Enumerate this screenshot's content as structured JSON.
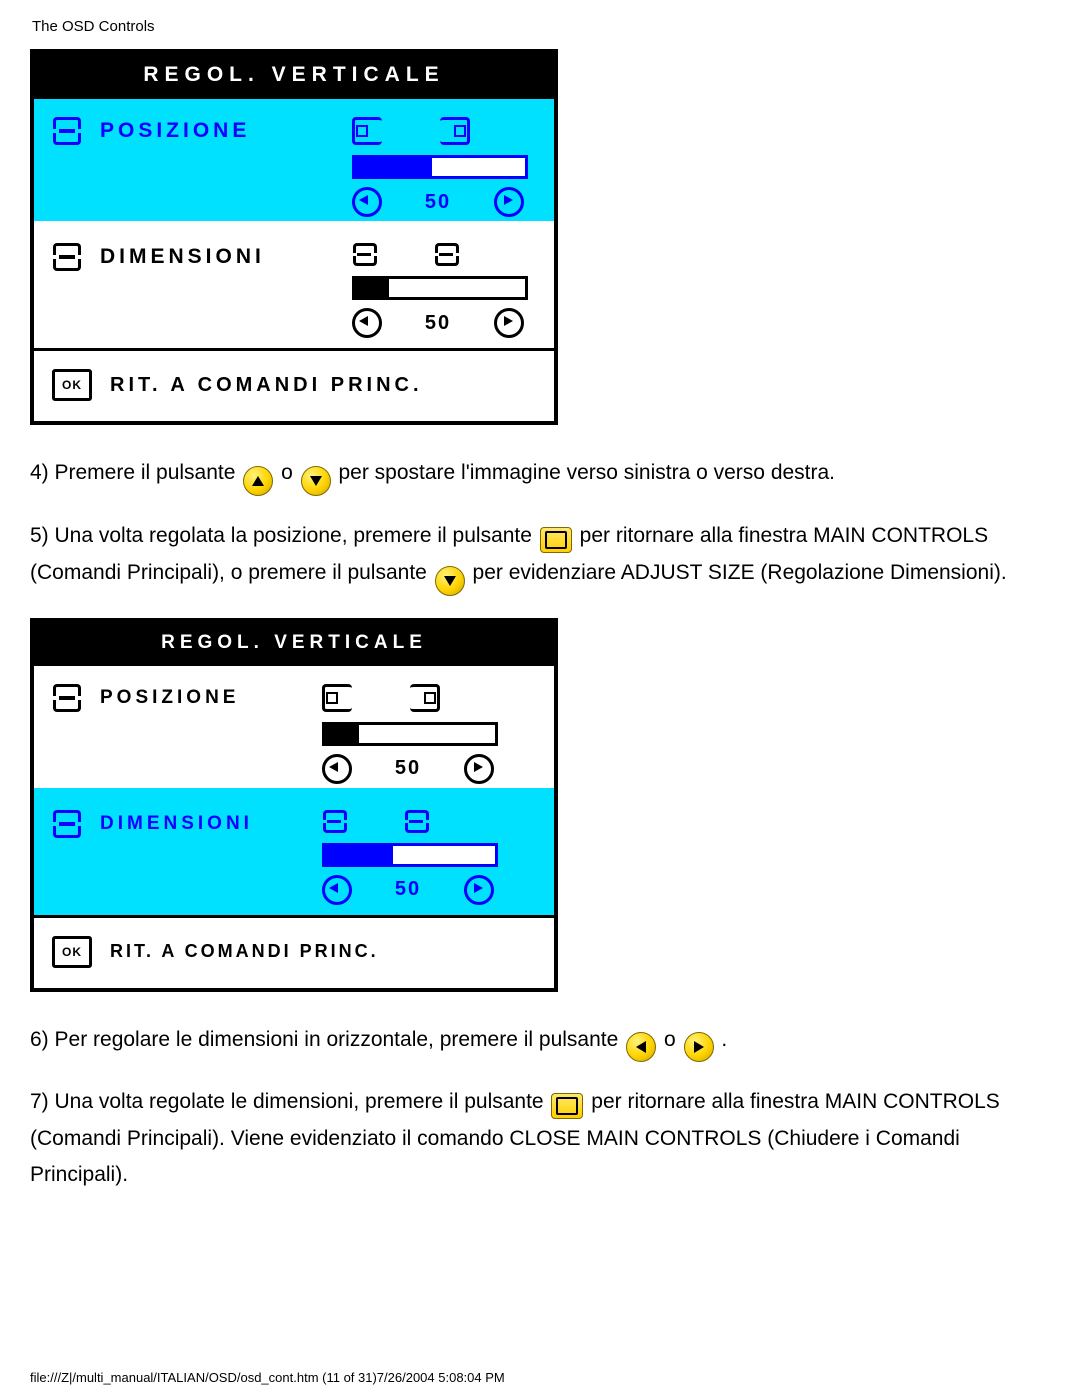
{
  "header": {
    "title": "The OSD Controls"
  },
  "osd1": {
    "title": "REGOL. VERTICALE",
    "position": {
      "label": "POSIZIONE",
      "value": "50",
      "fill": 45
    },
    "size": {
      "label": "DIMENSIONI",
      "value": "50",
      "fill": 20
    },
    "footer": {
      "ok": "OK",
      "label": "RIT. A COMANDI PRINC."
    }
  },
  "step4": {
    "a": "4) Premere il pulsante ",
    "b": " o ",
    "c": " per spostare l'immagine verso sinistra o verso destra."
  },
  "step5": {
    "a": "5) Una volta regolata la posizione, premere il pulsante ",
    "b": " per ritornare alla finestra MAIN CONTROLS (Comandi Principali), o premere il pulsante ",
    "c": " per evidenziare ADJUST SIZE (Regolazione Dimensioni)."
  },
  "osd2": {
    "title": "REGOL. VERTICALE",
    "position": {
      "label": "POSIZIONE",
      "value": "50",
      "fill": 20
    },
    "size": {
      "label": "DIMENSIONI",
      "value": "50",
      "fill": 40
    },
    "footer": {
      "ok": "OK",
      "label": "RIT. A COMANDI PRINC."
    }
  },
  "step6": {
    "a": "6) Per regolare le dimensioni in orizzontale, premere il pulsante ",
    "b": " o ",
    "c": " ."
  },
  "step7": {
    "a": "7) Una volta regolate le dimensioni, premere il pulsante ",
    "b": " per ritornare alla finestra MAIN CONTROLS (Comandi Principali). Viene evidenziato il comando CLOSE MAIN CONTROLS (Chiudere i Comandi Principali)."
  },
  "footer_line": "file:///Z|/multi_manual/ITALIAN/OSD/osd_cont.htm (11 of 31)7/26/2004 5:08:04 PM"
}
